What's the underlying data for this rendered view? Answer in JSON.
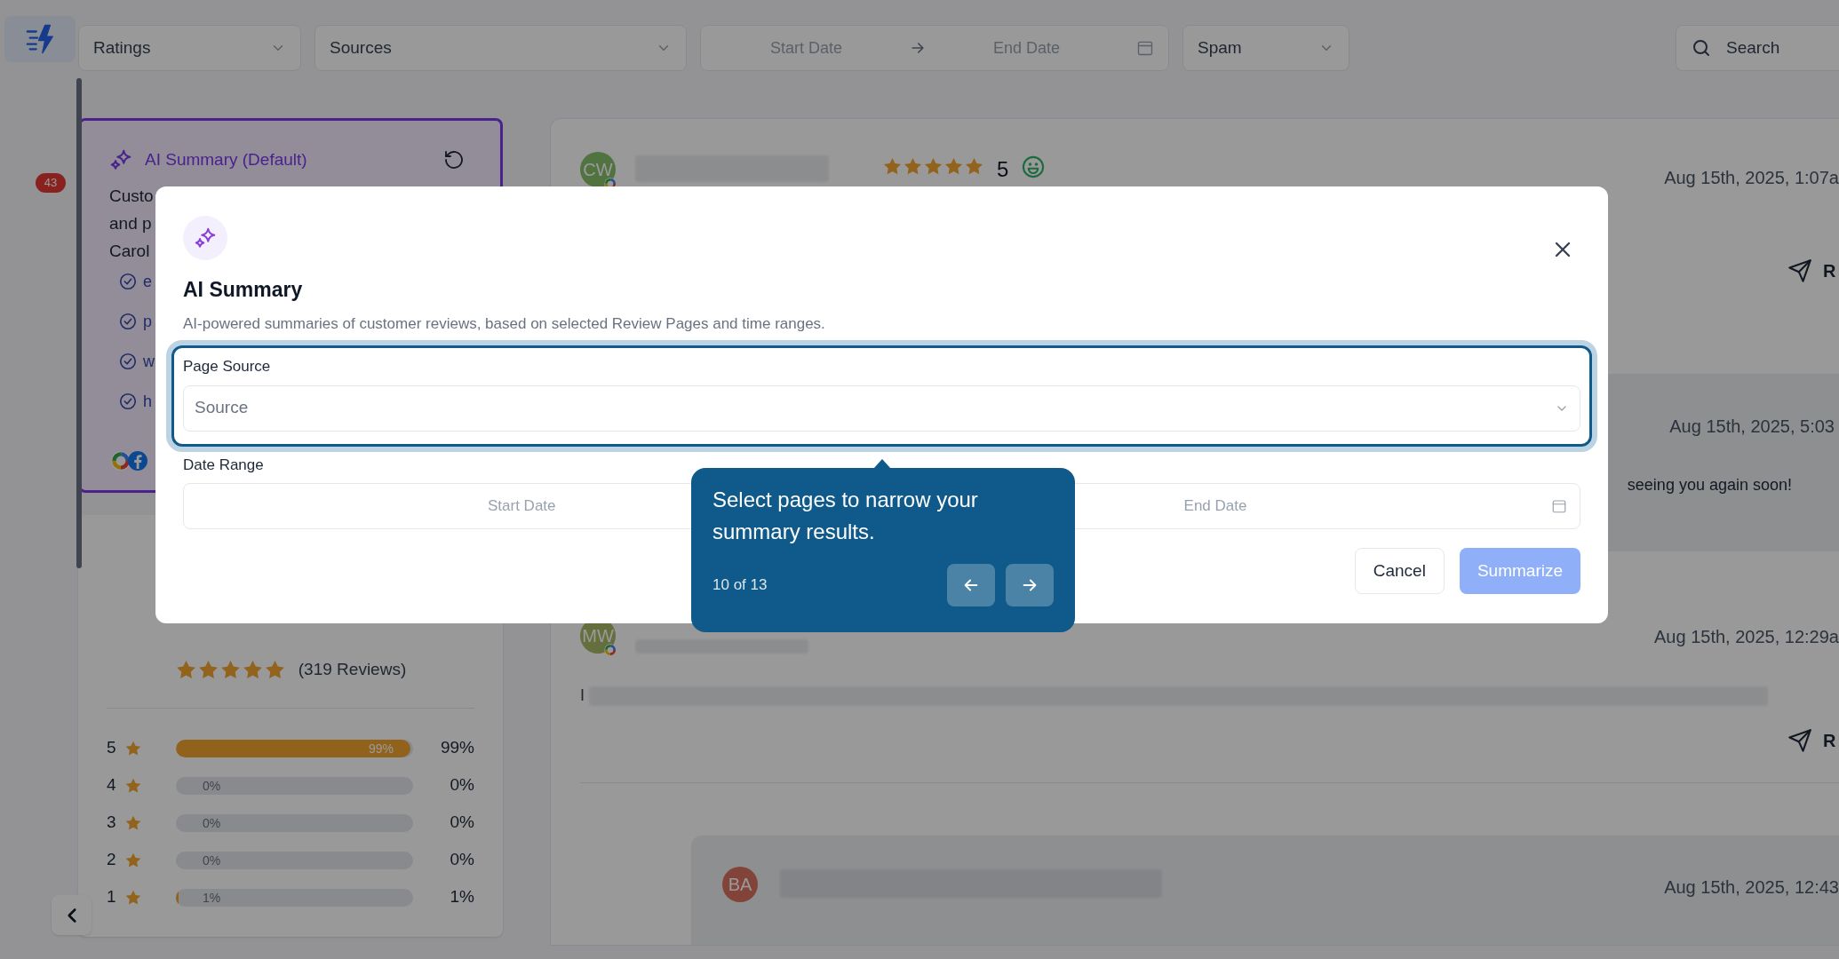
{
  "app_bar": {
    "badge": "43"
  },
  "filters": [
    {
      "kind": "select",
      "label": "Ratings"
    },
    {
      "kind": "select",
      "label": "Sources"
    },
    {
      "kind": "date_range",
      "start": "Start Date",
      "end": "End Date"
    },
    {
      "kind": "select",
      "label": "Spam"
    }
  ],
  "search": {
    "label": "Search"
  },
  "summary_card": {
    "title": "AI Summary (Default)",
    "lines": [
      "Custo",
      "and p",
      "Carol"
    ],
    "points": [
      "e",
      "p",
      "w",
      "h"
    ]
  },
  "rating_card": {
    "stars": 5,
    "count": "(319 Reviews)",
    "distribution": [
      {
        "rating": "5",
        "level": 0.99,
        "bar_label": "99%",
        "percent": "99%"
      },
      {
        "rating": "4",
        "level": 0,
        "bar_label": "0%",
        "percent": "0%"
      },
      {
        "rating": "3",
        "level": 0,
        "bar_label": "0%",
        "percent": "0%"
      },
      {
        "rating": "2",
        "level": 0,
        "bar_label": "0%",
        "percent": "0%"
      },
      {
        "rating": "1",
        "level": 0.01,
        "bar_label": "1%",
        "percent": "1%"
      }
    ]
  },
  "reviews": [
    {
      "kind": "review",
      "initials": "CW",
      "stars": 5,
      "score": "5",
      "date": "Aug 15th, 2025, 1:07a",
      "reply": "R"
    },
    {
      "kind": "response",
      "date": "Aug 15th, 2025, 5:03",
      "text": "seeing you again soon!"
    },
    {
      "kind": "review",
      "initials": "MW",
      "date": "Aug 15th, 2025, 12:29a",
      "excerpt": "I",
      "reply": "R"
    },
    {
      "kind": "response",
      "initials": "BA",
      "date": "Aug 15th, 2025, 12:43"
    }
  ],
  "modal": {
    "title": "AI Summary",
    "description": "AI-powered summaries of customer reviews, based on selected Review Pages and time ranges.",
    "page_source": {
      "label": "Page Source",
      "placeholder": "Source"
    },
    "date_range": {
      "label": "Date Range",
      "start": "Start Date",
      "end": "End Date"
    },
    "buttons": [
      {
        "kind": "secondary",
        "label": "Cancel",
        "disabled": false
      },
      {
        "kind": "primary",
        "label": "Summarize",
        "disabled": true
      }
    ]
  },
  "tour": {
    "text": "Select pages to narrow your summary results.",
    "step": "10 of 13"
  }
}
